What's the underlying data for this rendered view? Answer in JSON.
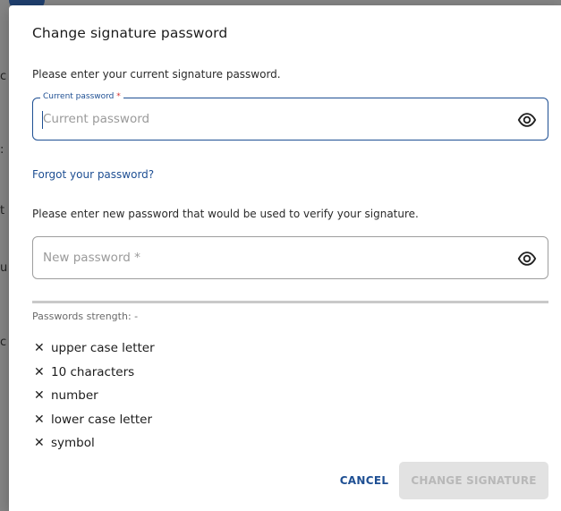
{
  "dialog": {
    "title": "Change signature password",
    "current_prompt": "Please enter your current signature password.",
    "current_field": {
      "label": "Current password",
      "required_mark": "*",
      "placeholder": "Current password",
      "value": "",
      "toggle_icon": "eye-icon"
    },
    "forgot_link": "Forgot your password?",
    "new_prompt": "Please enter new password that would be used to verify your signature.",
    "new_field": {
      "placeholder": "New password *",
      "value": "",
      "toggle_icon": "eye-icon"
    },
    "strength_label": "Passwords strength: -",
    "requirements": [
      {
        "label": "upper case letter",
        "met": false,
        "icon": "x-icon"
      },
      {
        "label": "10 characters",
        "met": false,
        "icon": "x-icon"
      },
      {
        "label": "number",
        "met": false,
        "icon": "x-icon"
      },
      {
        "label": "lower case letter",
        "met": false,
        "icon": "x-icon"
      },
      {
        "label": "symbol",
        "met": false,
        "icon": "x-icon"
      }
    ],
    "cancel_label": "CANCEL",
    "submit_label": "CHANGE SIGNATURE",
    "submit_enabled": false
  },
  "colors": {
    "accent": "#1e4f93",
    "required": "#d32f2f",
    "disabled_bg": "#e2e2e2",
    "disabled_text": "#b8b8b8",
    "backdrop": "#858585"
  }
}
